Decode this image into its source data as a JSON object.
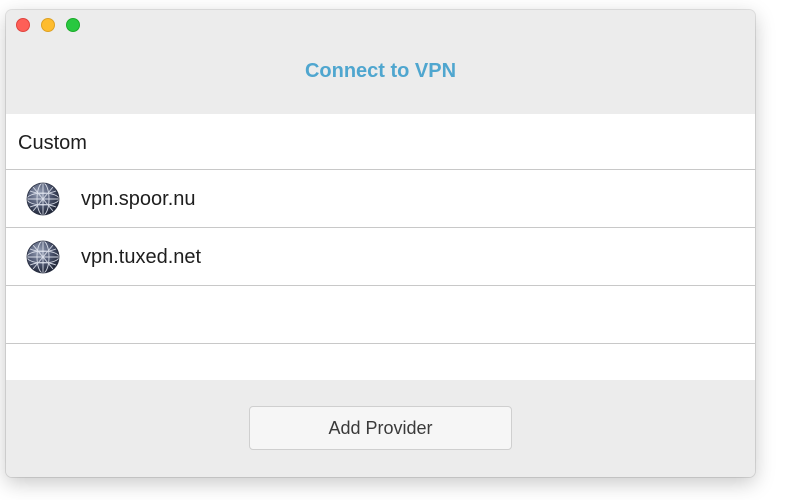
{
  "window": {
    "title": "Connect to VPN"
  },
  "list": {
    "section_header": "Custom",
    "providers": [
      {
        "label": "vpn.spoor.nu",
        "icon": "globe-icon"
      },
      {
        "label": "vpn.tuxed.net",
        "icon": "globe-icon"
      }
    ]
  },
  "footer": {
    "add_provider_label": "Add Provider"
  },
  "colors": {
    "title": "#4fa6cf",
    "window_bg": "#ececec",
    "list_bg": "#ffffff",
    "separator": "#c8c8c8",
    "close": "#fe5f57",
    "minimize": "#febc2e",
    "maximize": "#28c840"
  }
}
